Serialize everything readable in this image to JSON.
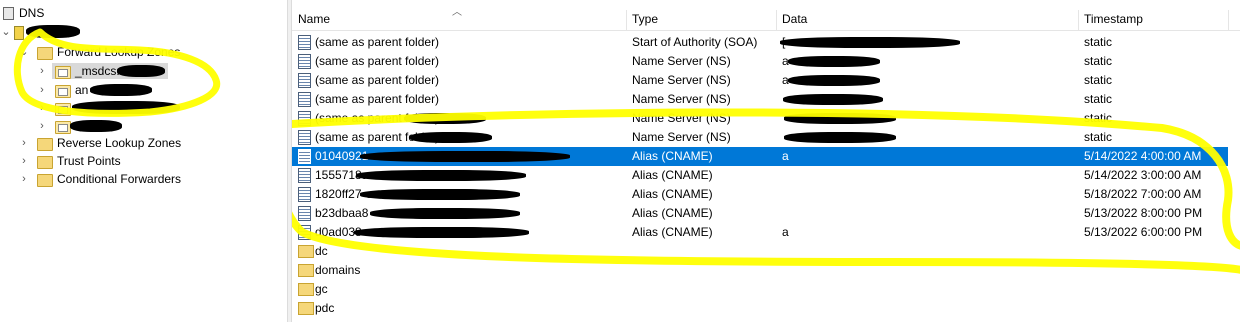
{
  "tree": {
    "root_label": "DNS",
    "items": [
      {
        "label": "Forward Lookup Zones"
      },
      {
        "label": "_msdcs."
      },
      {
        "label": "an"
      },
      {
        "label": ""
      },
      {
        "label": ""
      },
      {
        "label": "Reverse Lookup Zones"
      },
      {
        "label": "Trust Points"
      },
      {
        "label": "Conditional Forwarders"
      }
    ]
  },
  "list": {
    "columns": [
      "Name",
      "Type",
      "Data",
      "Timestamp"
    ],
    "rows": [
      {
        "name": "(same as parent folder)",
        "type": "Start of Authority (SOA)",
        "data": "[",
        "timestamp": "static",
        "icon": "record-icon"
      },
      {
        "name": "(same as parent folder)",
        "type": "Name Server (NS)",
        "data": "a",
        "timestamp": "static",
        "icon": "record-icon"
      },
      {
        "name": "(same as parent folder)",
        "type": "Name Server (NS)",
        "data": "a",
        "timestamp": "static",
        "icon": "record-icon"
      },
      {
        "name": "(same as parent folder)",
        "type": "Name Server (NS)",
        "data": "",
        "timestamp": "static",
        "icon": "record-icon"
      },
      {
        "name": "(same as parent folder)",
        "type": "Name Server (NS)",
        "data": "",
        "timestamp": "static",
        "icon": "record-icon"
      },
      {
        "name": "(same as parent folder)",
        "type": "Name Server (NS)",
        "data": "",
        "timestamp": "static",
        "icon": "record-icon"
      },
      {
        "name": "01040921-",
        "type": "Alias (CNAME)",
        "data": "a",
        "timestamp": "5/14/2022 4:00:00 AM",
        "icon": "record-icon",
        "selected": true
      },
      {
        "name": "1555718a",
        "type": "Alias (CNAME)",
        "data": "",
        "timestamp": "5/14/2022 3:00:00 AM",
        "icon": "record-icon"
      },
      {
        "name": "1820ff27-e",
        "type": "Alias (CNAME)",
        "data": "",
        "timestamp": "5/18/2022 7:00:00 AM",
        "icon": "record-icon"
      },
      {
        "name": "b23dbaa8",
        "type": "Alias (CNAME)",
        "data": "",
        "timestamp": "5/13/2022 8:00:00 PM",
        "icon": "record-icon"
      },
      {
        "name": "d0ad038",
        "type": "Alias (CNAME)",
        "data": "a",
        "timestamp": "5/13/2022 6:00:00 PM",
        "icon": "record-icon"
      },
      {
        "name": "dc",
        "type": "",
        "data": "",
        "timestamp": "",
        "icon": "folder-icon"
      },
      {
        "name": "domains",
        "type": "",
        "data": "",
        "timestamp": "",
        "icon": "folder-icon"
      },
      {
        "name": "gc",
        "type": "",
        "data": "",
        "timestamp": "",
        "icon": "folder-icon"
      },
      {
        "name": "pdc",
        "type": "",
        "data": "",
        "timestamp": "",
        "icon": "folder-icon"
      }
    ]
  },
  "colors": {
    "selection": "#0078d7",
    "highlight_marker": "#ffff00",
    "redaction": "#000000"
  }
}
